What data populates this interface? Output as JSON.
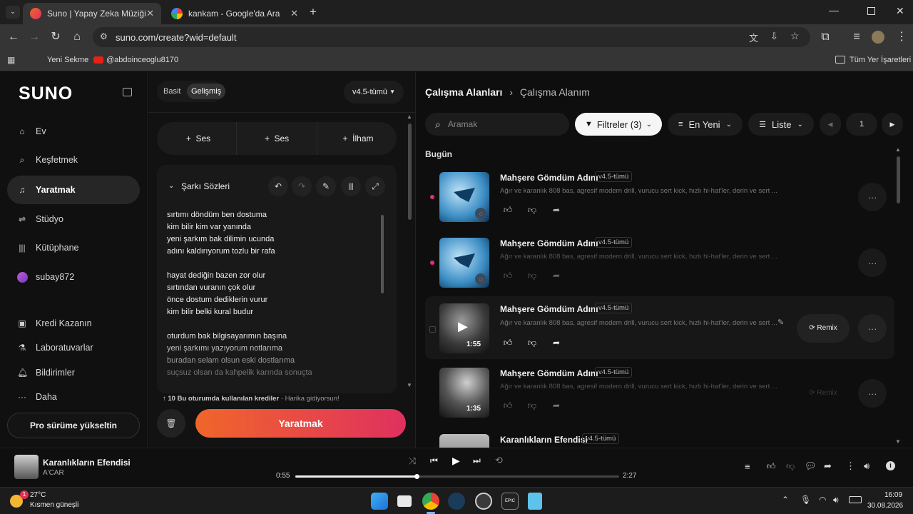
{
  "browser": {
    "tabs": [
      {
        "label": "Suno | Yapay Zeka Müziği",
        "active": true
      },
      {
        "label": "kankam - Google'da Ara",
        "active": false
      }
    ],
    "url": "suno.com/create?wid=default",
    "bookmarks": {
      "new_tab": "Yeni Sekme",
      "channel": "@abdoinceoglu8170",
      "all": "Tüm Yer İşaretleri"
    }
  },
  "sidebar": {
    "logo": "SUNO",
    "nav": [
      {
        "label": "Ev",
        "icon": "home-icon",
        "active": false
      },
      {
        "label": "Keşfetmek",
        "icon": "search-icon",
        "active": false
      },
      {
        "label": "Yaratmak",
        "icon": "music-note-icon",
        "active": true
      },
      {
        "label": "Stüdyo",
        "icon": "studio-icon",
        "active": false
      },
      {
        "label": "Kütüphane",
        "icon": "library-icon",
        "active": false
      },
      {
        "label": "subay872",
        "icon": "avatar-icon",
        "active": false
      }
    ],
    "secondary": [
      {
        "label": "Kredi Kazanın",
        "icon": "gift-icon"
      },
      {
        "label": "Laboratuvarlar",
        "icon": "flask-icon"
      },
      {
        "label": "Bildirimler",
        "icon": "bell-icon"
      },
      {
        "label": "Daha",
        "icon": "more-icon"
      }
    ],
    "upgrade": "Pro sürüme yükseltin"
  },
  "create": {
    "mode_simple": "Basit",
    "mode_advanced": "Gelişmiş",
    "model": "v4.5-tümü",
    "add_buttons": [
      "Ses",
      "Ses",
      "İlham"
    ],
    "lyrics_title": "Şarkı Sözleri",
    "lyrics": [
      "sırtımı döndüm ben dostuma",
      "kim bilir kim var yanında",
      "yeni şarkım bak dilimin ucunda",
      "adını kaldırıyorum tozlu bir rafa",
      "",
      "hayat dediğin bazen zor olur",
      "sırtından vuranın çok olur",
      "önce dostum dediklerin vurur",
      "kim bilir belki kural budur",
      "",
      "oturdum bak bilgisayarımın başına",
      "yeni şarkımı yazıyorum notlarıma",
      "buradan selam olsun eski dostlarıma",
      "suçsuz olsan da kahpelik karında sonuçta"
    ],
    "credits_count": "10",
    "credits_text": "Bu oturumda kullanılan krediler",
    "credits_note": "Harika gidiyorsun!",
    "create_button": "Yaratmak"
  },
  "workspace": {
    "breadcrumb_root": "Çalışma Alanları",
    "breadcrumb_current": "Çalışma Alanım",
    "search_placeholder": "Aramak",
    "filters": "Filtreler (3)",
    "sort": "En Yeni",
    "view": "Liste",
    "page": "1",
    "section": "Bugün",
    "remix_label": "Remix",
    "songs": [
      {
        "title": "Mahşere Gömdüm Adını",
        "version": "v4.5-tümü",
        "desc": "Ağır ve karanlık 808 bas, agresif modern drill, vurucu sert kick, hızlı hi-hat'ler, derin ve sert ...",
        "duration": "",
        "status": "generating"
      },
      {
        "title": "Mahşere Gömdüm Adını",
        "version": "v4.5-tümü",
        "desc": "Ağır ve karanlık 808 bas, agresif modern drill, vurucu sert kick, hızlı hi-hat'ler, derin ve sert ...",
        "duration": "",
        "status": "generating"
      },
      {
        "title": "Mahşere Gömdüm Adını",
        "version": "v4.5-tümü",
        "desc": "Ağır ve karanlık 808 bas, agresif modern drill, vurucu sert kick, hızlı hi-hat'ler, derin ve sert ...",
        "duration": "1:55",
        "status": "ready"
      },
      {
        "title": "Mahşere Gömdüm Adını",
        "version": "v4.5-tümü",
        "desc": "Ağır ve karanlık 808 bas, agresif modern drill, vurucu sert kick, hızlı hi-hat'ler, derin ve sert ...",
        "duration": "1:35",
        "status": "ready"
      },
      {
        "title": "Karanlıkların Efendisi",
        "version": "v4.5-tümü",
        "desc": "",
        "duration": "",
        "status": "ready"
      }
    ]
  },
  "player": {
    "title": "Karanlıkların Efendisi",
    "artist": "A'CAR",
    "elapsed": "0:55",
    "total": "2:27",
    "progress": 0.374
  },
  "taskbar": {
    "temperature": "27°C",
    "weather": "Kısmen güneşli",
    "time": "16:09",
    "date": "30.08.2026",
    "badge": "1"
  },
  "colors": {
    "accent_start": "#f0662a",
    "accent_end": "#e0305f",
    "pink_dot": "#e0307a"
  }
}
